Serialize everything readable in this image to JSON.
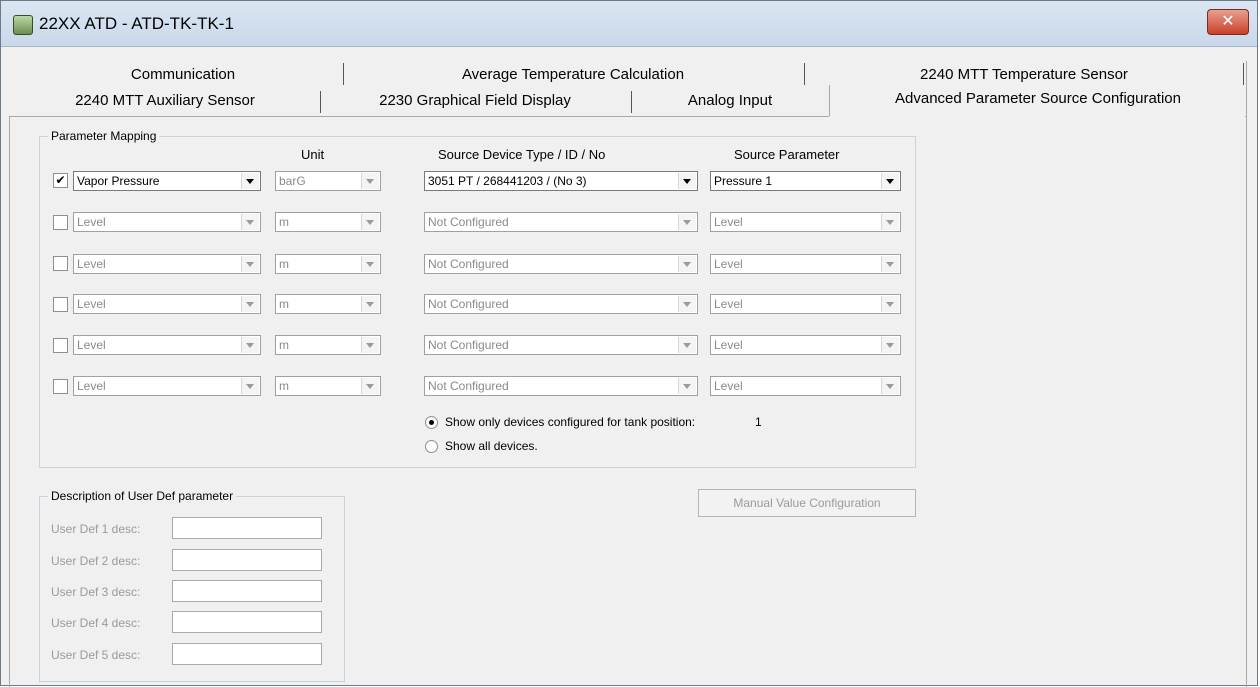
{
  "window": {
    "title": "22XX ATD  - ATD-TK-TK-1",
    "close_label": "✕"
  },
  "tabs_row1": [
    "Communication",
    "Average Temperature Calculation",
    "2240 MTT Temperature Sensor"
  ],
  "tabs_row2": [
    "2240 MTT Auxiliary Sensor",
    "2230 Graphical Field Display",
    "Analog Input",
    "Advanced Parameter Source Configuration"
  ],
  "active_tab": "Advanced Parameter Source Configuration",
  "mapping": {
    "legend": "Parameter Mapping",
    "headers": {
      "unit": "Unit",
      "source_device": "Source Device Type / ID / No",
      "source_param": "Source Parameter"
    },
    "rows": [
      {
        "checked": true,
        "parameter": "Vapor Pressure",
        "unit": "barG",
        "source_device": "3051  PT / 268441203 / (No 3)",
        "source_param": "Pressure 1"
      },
      {
        "checked": false,
        "parameter": "Level",
        "unit": "m",
        "source_device": "Not Configured",
        "source_param": "Level"
      },
      {
        "checked": false,
        "parameter": "Level",
        "unit": "m",
        "source_device": "Not Configured",
        "source_param": "Level"
      },
      {
        "checked": false,
        "parameter": "Level",
        "unit": "m",
        "source_device": "Not Configured",
        "source_param": "Level"
      },
      {
        "checked": false,
        "parameter": "Level",
        "unit": "m",
        "source_device": "Not Configured",
        "source_param": "Level"
      },
      {
        "checked": false,
        "parameter": "Level",
        "unit": "m",
        "source_device": "Not Configured",
        "source_param": "Level"
      }
    ],
    "radio_show_configured": "Show only devices configured for tank position:",
    "tank_position": "1",
    "radio_show_all": "Show all devices."
  },
  "manual_button": "Manual Value Configuration",
  "user_def": {
    "legend": "Description of User Def parameter",
    "labels": [
      "User Def 1 desc:",
      "User Def 2 desc:",
      "User Def 3 desc:",
      "User Def 4 desc:",
      "User Def 5 desc:"
    ]
  }
}
